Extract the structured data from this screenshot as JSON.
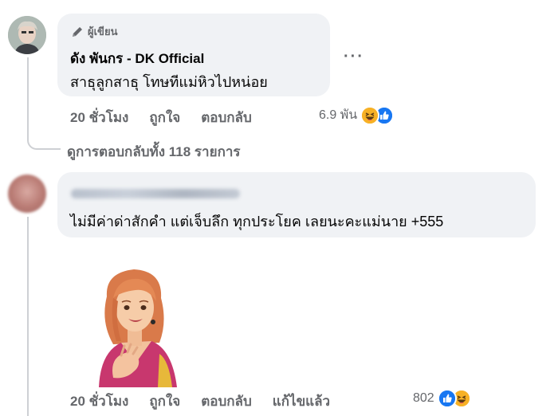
{
  "comment1": {
    "badge_label": "ผู้เขียน",
    "author": "ดัง พันกร - DK Official",
    "text": "สาธุลูกสาธุ โทษทีแม่หิวไปหน่อย",
    "more": "···",
    "time": "20 ชั่วโมง",
    "like": "ถูกใจ",
    "reply": "ตอบกลับ",
    "reaction_count": "6.9 พัน",
    "reaction_icons": [
      "haha-icon",
      "like-icon"
    ],
    "view_replies": "ดูการตอบกลับทั้ง 118 รายการ"
  },
  "comment2": {
    "text": "ไม่มีค่าด่าสักคำ แต่เจ็บลึก ทุกประโยค เลยนะคะแม่นาย +555",
    "time": "20 ชั่วโมง",
    "like": "ถูกใจ",
    "reply": "ตอบกลับ",
    "edited": "แก้ไขแล้ว",
    "reaction_count": "802",
    "reaction_icons": [
      "like-icon",
      "haha-icon"
    ]
  },
  "colors": {
    "bubble": "#f0f2f5",
    "secondary_text": "#65676b",
    "like_blue": "#1877f2",
    "haha_yellow": "#f7b125"
  }
}
